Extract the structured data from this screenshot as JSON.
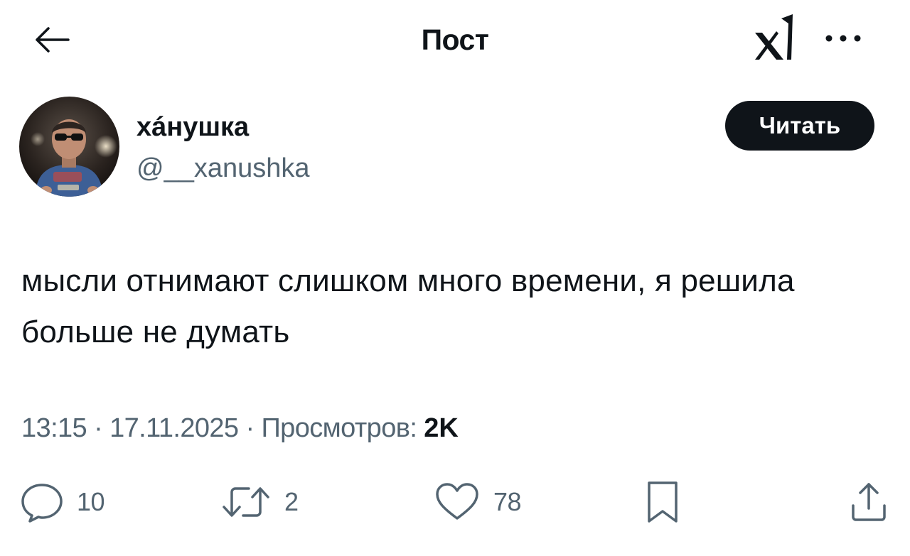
{
  "header": {
    "title": "Пост",
    "logo_text": "XI",
    "icons": {
      "back": "arrow-left-icon",
      "more": "more-dots-icon"
    }
  },
  "author": {
    "display_name": "xáнушка",
    "handle": "@__xanushka",
    "follow_label": "Читать"
  },
  "post": {
    "text": "мысли отнимают слишком много времени, я решила больше не думать"
  },
  "meta": {
    "time": "13:15",
    "separator": "·",
    "date": "17.11.2025",
    "views_label": "Просмотров:",
    "views_count": "2K"
  },
  "actions": {
    "reply_count": "10",
    "retweet_count": "2",
    "like_count": "78"
  },
  "colors": {
    "text": "#0f1419",
    "secondary": "#536471",
    "button_bg": "#0f1419",
    "background": "#ffffff"
  }
}
